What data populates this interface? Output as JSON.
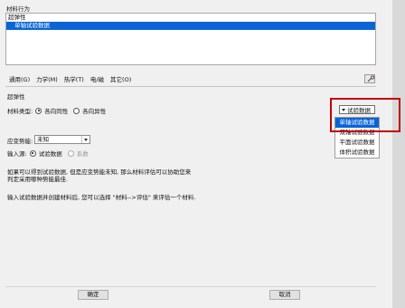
{
  "material_behavior": {
    "title": "材料行为",
    "items": [
      "超弹性",
      "单轴试验数据"
    ]
  },
  "menu": {
    "items": [
      "通用(G)",
      "力学(M)",
      "热学(T)",
      "电/磁",
      "其它(O)"
    ]
  },
  "hyperelastic": {
    "title": "超弹性",
    "material_type_label": "材料类型:",
    "isotropic": "各向同性",
    "anisotropic": "各向异性",
    "strain_energy_label": "应变势能:",
    "strain_energy_value": "未知",
    "input_source_label": "输入源:",
    "test_data": "试验数据",
    "coefficients": "系数"
  },
  "info": {
    "line1": "如果可以得到试验数据, 但是应变势能未知, 那么材料评估可以协助您来",
    "line2": "判定采用哪种势能最佳.",
    "line3": "输入试验数据并创建材料后, 您可以选择 \"材料-->评估\" 来评估一个材料."
  },
  "dropdown": {
    "trigger_label": "试验数据",
    "options": [
      "单轴试验数据",
      "双轴试验数据",
      "平面试验数据",
      "体积试验数据"
    ],
    "selected_index": 0
  },
  "buttons": {
    "ok": "确定",
    "cancel": "取消"
  },
  "colors": {
    "selection": "#0a64d6",
    "highlight_border": "#c30000"
  }
}
